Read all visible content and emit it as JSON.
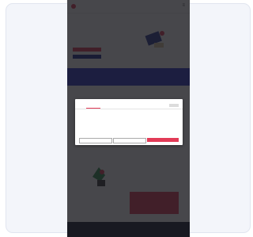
{
  "colors": {
    "accent": "#e23b57",
    "navy": "#1b2a8c",
    "band": "#2a34c9",
    "footer": "#161b2e"
  },
  "header": {
    "logo_text": "",
    "menu_icon": "hamburger-icon"
  },
  "hero": {
    "title": "",
    "copy": "",
    "primary_cta": "",
    "secondary_cta": ""
  },
  "band": {
    "text": ""
  },
  "section": {
    "title": ""
  },
  "feature": {
    "title": "",
    "copy": "",
    "link": "",
    "cta": ""
  },
  "footer": {
    "text": ""
  },
  "cookie_modal": {
    "tabs": [
      "",
      "",
      ""
    ],
    "active_tab_index": 0,
    "heading": "",
    "body": "",
    "buttons": {
      "deny": "",
      "customize": "",
      "allow": ""
    }
  }
}
